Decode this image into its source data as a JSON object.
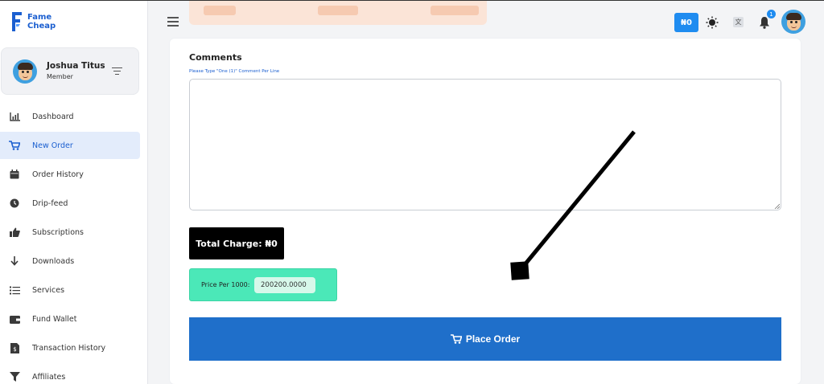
{
  "brand": {
    "line1": "Fame",
    "line2": "Cheap",
    "color": "#1b5fd0"
  },
  "user": {
    "name": "Joshua Titus",
    "role": "Member"
  },
  "sidebar": {
    "items": [
      {
        "label": "Dashboard",
        "icon": "bar-chart-icon",
        "active": false
      },
      {
        "label": "New Order",
        "icon": "cart-icon",
        "active": true
      },
      {
        "label": "Order History",
        "icon": "calendar-icon",
        "active": false
      },
      {
        "label": "Drip-feed",
        "icon": "clock-icon",
        "active": false
      },
      {
        "label": "Subscriptions",
        "icon": "thumbs-up-icon",
        "active": false
      },
      {
        "label": "Downloads",
        "icon": "arrow-down-icon",
        "active": false
      },
      {
        "label": "Services",
        "icon": "list-icon",
        "active": false
      },
      {
        "label": "Fund Wallet",
        "icon": "wallet-icon",
        "active": false
      },
      {
        "label": "Transaction History",
        "icon": "receipt-icon",
        "active": false
      },
      {
        "label": "Affiliates",
        "icon": "funnel-icon",
        "active": false
      }
    ]
  },
  "header": {
    "balance": "₦0",
    "notification_count": "1",
    "accent_color": "#1f8cf0"
  },
  "form": {
    "comments_label": "Comments",
    "comments_hint": "Please Type \"One (1)\" Comment Per Line",
    "comments_value": "",
    "total_charge": "Total Charge: ₦0",
    "price_label": "Price Per 1000:",
    "price_value": "200200.0000",
    "place_order_label": "Place Order",
    "button_color": "#1f6fca",
    "price_box_color": "#4be8b8"
  }
}
